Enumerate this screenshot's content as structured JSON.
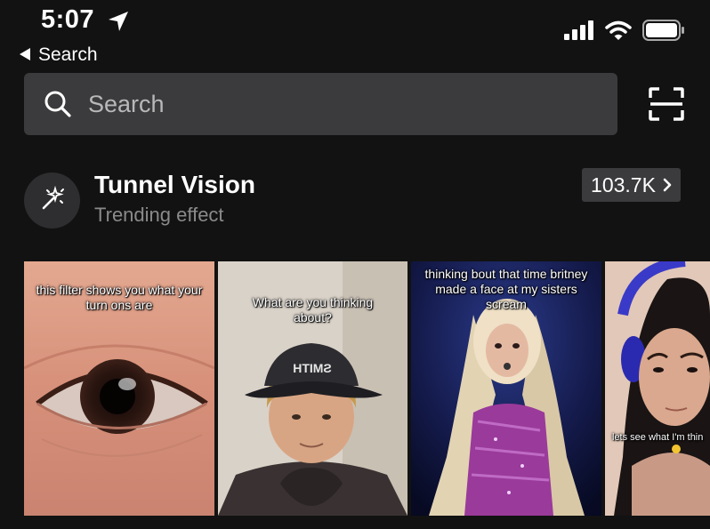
{
  "status": {
    "time": "5:07",
    "icons": [
      "location-arrow-icon",
      "signal-icon",
      "wifi-icon",
      "battery-icon"
    ]
  },
  "nav": {
    "back_label": "Search"
  },
  "search": {
    "placeholder": "Search"
  },
  "effect": {
    "title": "Tunnel Vision",
    "subtitle": "Trending effect",
    "count": "103.7K"
  },
  "thumbnails": [
    {
      "caption": "this filter shows you what your turn ons are"
    },
    {
      "caption": "What are you thinking about?",
      "cap_text": "HTIMƧ"
    },
    {
      "caption": "thinking bout that time britney made a face at my sisters scream"
    },
    {
      "caption": "lets see what I'm thin"
    }
  ],
  "colors": {
    "background": "#121212",
    "surface": "#3b3b3d",
    "muted_text": "#8a8a8a"
  }
}
